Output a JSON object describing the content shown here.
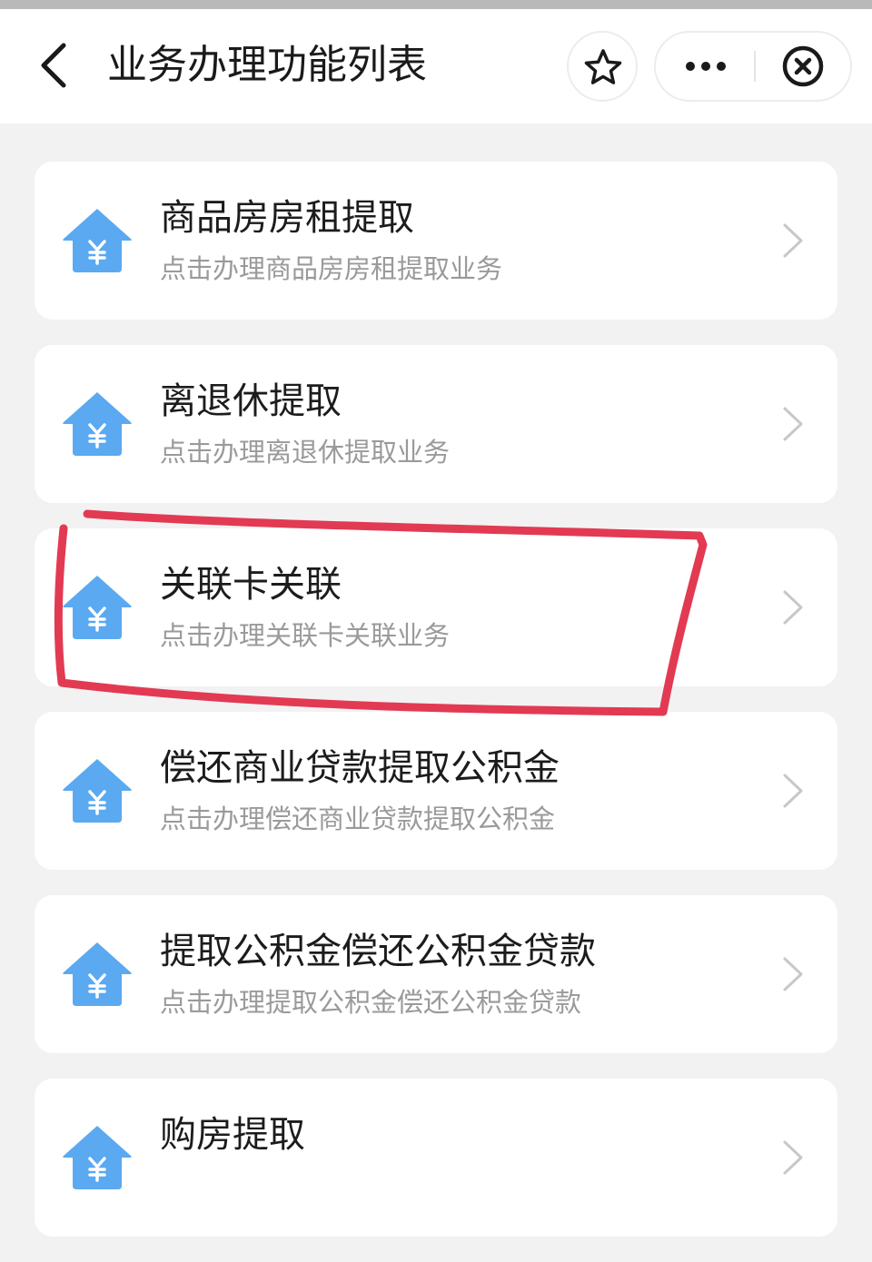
{
  "nav": {
    "title": "业务办理功能列表",
    "icons": {
      "back": "chevron-left-icon",
      "favorite": "star-icon",
      "more": "more-dots-icon",
      "close": "close-circle-icon"
    }
  },
  "items": [
    {
      "title": "商品房房租提取",
      "desc": "点击办理商品房房租提取业务"
    },
    {
      "title": "离退休提取",
      "desc": "点击办理离退休提取业务"
    },
    {
      "title": "关联卡关联",
      "desc": "点击办理关联卡关联业务"
    },
    {
      "title": "偿还商业贷款提取公积金",
      "desc": "点击办理偿还商业贷款提取公积金"
    },
    {
      "title": "提取公积金偿还公积金贷款",
      "desc": "点击办理提取公积金偿还公积金贷款"
    },
    {
      "title": "购房提取",
      "desc": ""
    }
  ],
  "colors": {
    "icon_blue": "#5aa9f1",
    "highlight_red": "#e23a52",
    "background": "#f2f2f2"
  }
}
